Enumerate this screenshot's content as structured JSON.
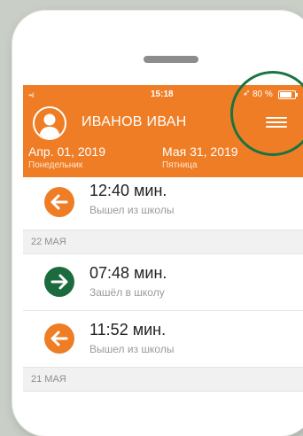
{
  "status_bar": {
    "time": "15:18",
    "battery_percent": "80 %",
    "signal": "••ıl"
  },
  "header": {
    "user_name": "ИВАНОВ ИВАН",
    "start_date": "Апр. 01, 2019",
    "start_weekday": "Понедельник",
    "end_date": "Мая 31, 2019",
    "end_weekday": "Пятница"
  },
  "list": {
    "entry_0": {
      "time": "12:40 мин.",
      "status": "Вышел из школы",
      "direction": "out"
    },
    "day_1": "22 МАЯ",
    "entry_1": {
      "time": "07:48 мин.",
      "status": "Зашёл в школу",
      "direction": "in"
    },
    "entry_2": {
      "time": "11:52 мин.",
      "status": "Вышел из школы",
      "direction": "out"
    },
    "day_2": "21 МАЯ"
  },
  "colors": {
    "accent": "#ef7d25",
    "enter": "#1c6b3f",
    "highlight_ring": "#1a7340"
  },
  "icons": {
    "exit": "arrow-left-icon",
    "enter": "arrow-right-icon",
    "menu": "hamburger-menu-icon",
    "avatar": "user-avatar-icon"
  }
}
